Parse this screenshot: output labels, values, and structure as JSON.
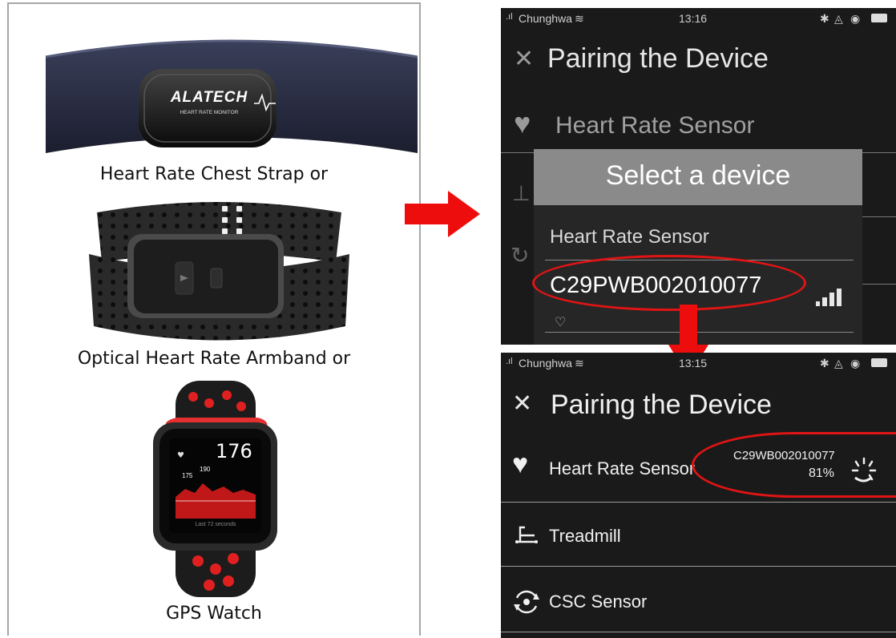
{
  "left": {
    "products": [
      {
        "caption": "Heart Rate Chest Strap or",
        "brand": "ALATECH",
        "sub": "HEART RATE MONITOR"
      },
      {
        "caption": "Optical Heart Rate Armband or"
      },
      {
        "caption": "GPS Watch",
        "watch_value": "176",
        "watch_max": "190",
        "watch_min": "175",
        "watch_footer": "Last 72 seconds"
      }
    ]
  },
  "top_screen": {
    "status": {
      "carrier": "Chunghwa",
      "time": "13:16"
    },
    "title": "Pairing the Device",
    "sensor_row": "Heart Rate Sensor",
    "dialog": {
      "title": "Select a device",
      "category": "Heart Rate Sensor",
      "device_id": "C29PWB002010077"
    }
  },
  "bottom_screen": {
    "status": {
      "carrier": "Chunghwa",
      "time": "13:15"
    },
    "title": "Pairing the Device",
    "rows": [
      {
        "label": "Heart Rate Sensor",
        "icon": "heart-icon",
        "device": "C29WB002010077",
        "battery": "81%"
      },
      {
        "label": "Treadmill",
        "icon": "treadmill-icon"
      },
      {
        "label": "CSC Sensor",
        "icon": "csc-cycle-icon"
      }
    ]
  },
  "colors": {
    "accent_red": "#e01414",
    "phone_bg": "#1a1a1a",
    "dialog_header": "#8a8a8a"
  }
}
